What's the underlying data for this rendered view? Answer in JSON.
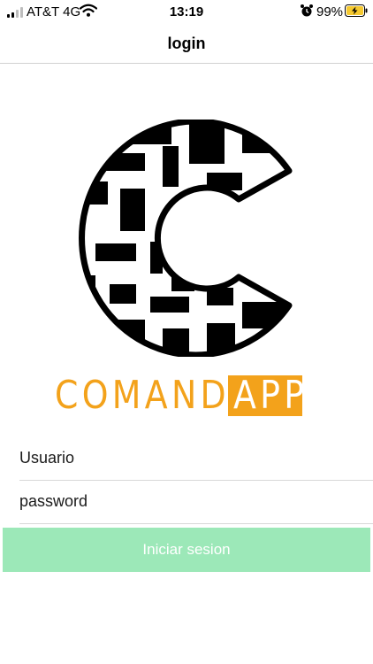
{
  "status_bar": {
    "carrier": "AT&T 4G",
    "time": "13:19",
    "battery_percent": "99%",
    "icons": [
      "signal-icon",
      "wifi-icon",
      "alarm-icon",
      "battery-charging-icon"
    ]
  },
  "nav": {
    "title": "login"
  },
  "logo": {
    "brand_part1": "COMAND",
    "brand_part2": "APP",
    "brand_color": "#f3a21b"
  },
  "form": {
    "username_placeholder": "Usuario",
    "password_placeholder": "password",
    "submit_label": "Iniciar sesion",
    "submit_color": "#9ce8b8"
  }
}
